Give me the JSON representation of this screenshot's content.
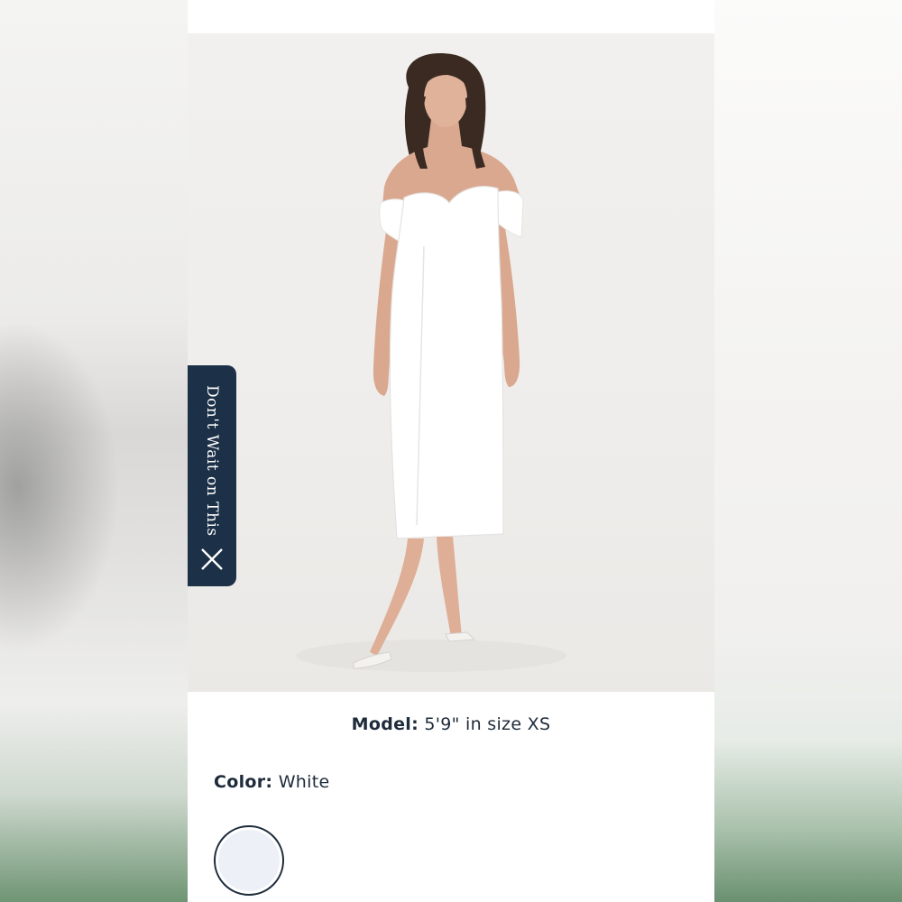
{
  "promo": {
    "label": "Don't Wait on This",
    "close_icon": "close-icon"
  },
  "product": {
    "image_alt": "Model wearing white off-the-shoulder midi dress",
    "model_label": "Model:",
    "model_value": "5'9\" in size XS",
    "color_label": "Color:",
    "color_value": "White",
    "swatches": [
      {
        "name": "White",
        "hex": "#edf0f7",
        "selected": true
      }
    ]
  },
  "colors": {
    "promo_bg": "#1c3047",
    "text": "#1e2b3a"
  }
}
